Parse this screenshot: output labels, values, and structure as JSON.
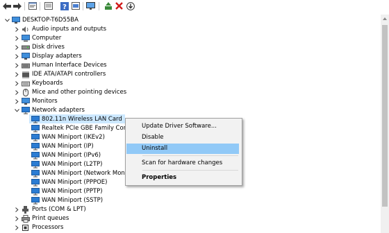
{
  "toolbar": {
    "buttons": [
      "back-icon",
      "forward-icon",
      "properties-icon",
      "show-hidden-icon",
      "help-icon",
      "view-icon",
      "monitor-icon",
      "update-driver-icon",
      "uninstall-icon",
      "download-icon"
    ]
  },
  "tree": {
    "root": "DESKTOP-T6D55BA",
    "items": [
      {
        "label": "Audio inputs and outputs",
        "icon": "speaker-icon",
        "expanded": false
      },
      {
        "label": "Computer",
        "icon": "computer-icon",
        "expanded": false
      },
      {
        "label": "Disk drives",
        "icon": "disk-icon",
        "expanded": false
      },
      {
        "label": "Display adapters",
        "icon": "display-icon",
        "expanded": false
      },
      {
        "label": "Human Interface Devices",
        "icon": "hid-icon",
        "expanded": false
      },
      {
        "label": "IDE ATA/ATAPI controllers",
        "icon": "ide-icon",
        "expanded": false
      },
      {
        "label": "Keyboards",
        "icon": "keyboard-icon",
        "expanded": false
      },
      {
        "label": "Mice and other pointing devices",
        "icon": "mouse-icon",
        "expanded": false
      },
      {
        "label": "Monitors",
        "icon": "monitor-icon",
        "expanded": false
      },
      {
        "label": "Network adapters",
        "icon": "network-icon",
        "expanded": true
      },
      {
        "label": "Ports (COM & LPT)",
        "icon": "port-icon",
        "expanded": false
      },
      {
        "label": "Print queues",
        "icon": "printer-icon",
        "expanded": false
      },
      {
        "label": "Processors",
        "icon": "processor-icon",
        "expanded": false
      }
    ],
    "network_children": [
      "802.11n  Wireless LAN Card",
      "Realtek PCIe GBE Family Contro",
      "WAN Miniport (IKEv2)",
      "WAN Miniport (IP)",
      "WAN Miniport (IPv6)",
      "WAN Miniport (L2TP)",
      "WAN Miniport (Network Monit",
      "WAN Miniport (PPPOE)",
      "WAN Miniport (PPTP)",
      "WAN Miniport (SSTP)"
    ]
  },
  "context_menu": {
    "update": "Update Driver Software...",
    "disable": "Disable",
    "uninstall": "Uninstall",
    "scan": "Scan for hardware changes",
    "properties": "Properties"
  },
  "colors": {
    "selection": "#cce8ff",
    "menu_highlight": "#91c9f7",
    "icon_blue": "#2b7cd3"
  }
}
